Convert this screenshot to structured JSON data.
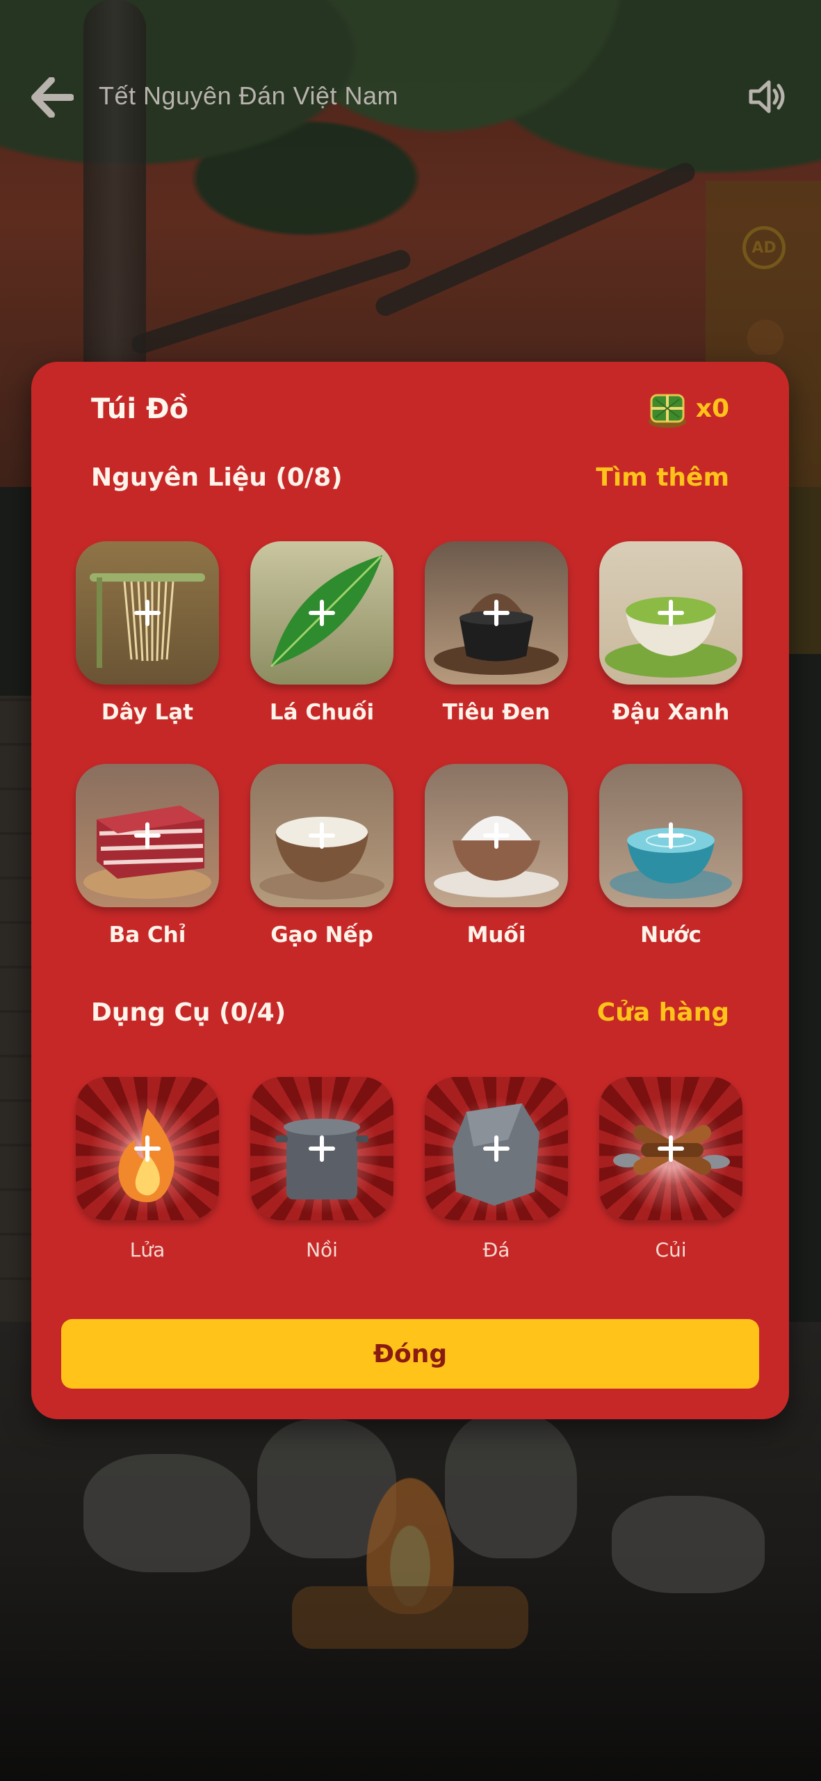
{
  "header": {
    "title": "Tết Nguyên Đán Việt Nam",
    "back_icon": "arrow-left-icon",
    "sound_icon": "speaker-icon"
  },
  "side": {
    "ad_label": "AD"
  },
  "inventory": {
    "title": "Túi Đồ",
    "currency_icon": "banh-chung-icon",
    "currency_count": "x0",
    "ingredients": {
      "title": "Nguyên Liệu (0/8)",
      "link": "Tìm thêm",
      "items": [
        {
          "label": "Dây Lạt",
          "icon": "bamboo-strings-icon"
        },
        {
          "label": "Lá Chuối",
          "icon": "banana-leaf-icon"
        },
        {
          "label": "Tiêu Đen",
          "icon": "black-pepper-icon"
        },
        {
          "label": "Đậu Xanh",
          "icon": "mung-bean-icon"
        },
        {
          "label": "Ba Chỉ",
          "icon": "pork-belly-icon"
        },
        {
          "label": "Gạo Nếp",
          "icon": "sticky-rice-icon"
        },
        {
          "label": "Muối",
          "icon": "salt-icon"
        },
        {
          "label": "Nước",
          "icon": "water-icon"
        }
      ]
    },
    "tools": {
      "title": "Dụng Cụ (0/4)",
      "link": "Cửa hàng",
      "items": [
        {
          "label": "Lửa",
          "icon": "fire-icon"
        },
        {
          "label": "Nồi",
          "icon": "pot-icon"
        },
        {
          "label": "Đá",
          "icon": "stone-icon"
        },
        {
          "label": "Củi",
          "icon": "firewood-icon"
        }
      ]
    },
    "close_label": "Đóng"
  },
  "colors": {
    "panel": "#c62828",
    "accent": "#ffc31a",
    "button_text": "#8a1b12"
  }
}
